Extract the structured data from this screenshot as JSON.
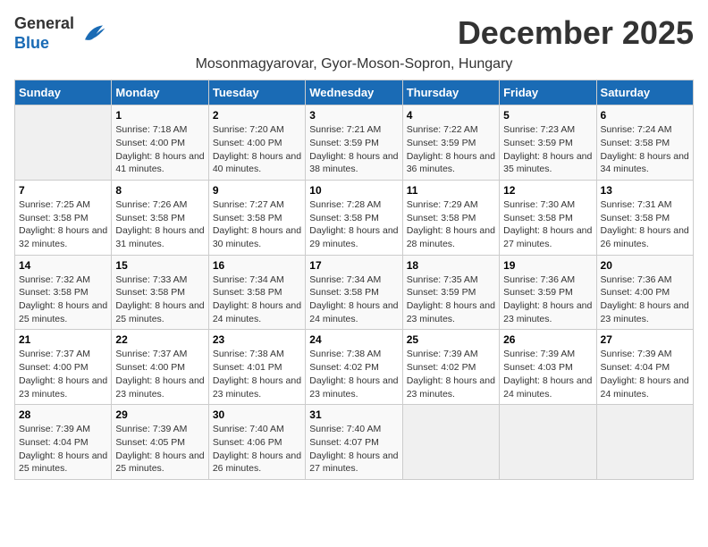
{
  "logo": {
    "general": "General",
    "blue": "Blue"
  },
  "title": "December 2025",
  "location": "Mosonmagyarovar, Gyor-Moson-Sopron, Hungary",
  "weekdays": [
    "Sunday",
    "Monday",
    "Tuesday",
    "Wednesday",
    "Thursday",
    "Friday",
    "Saturday"
  ],
  "weeks": [
    [
      {
        "day": "",
        "empty": true
      },
      {
        "day": "1",
        "sunrise": "Sunrise: 7:18 AM",
        "sunset": "Sunset: 4:00 PM",
        "daylight": "Daylight: 8 hours and 41 minutes."
      },
      {
        "day": "2",
        "sunrise": "Sunrise: 7:20 AM",
        "sunset": "Sunset: 4:00 PM",
        "daylight": "Daylight: 8 hours and 40 minutes."
      },
      {
        "day": "3",
        "sunrise": "Sunrise: 7:21 AM",
        "sunset": "Sunset: 3:59 PM",
        "daylight": "Daylight: 8 hours and 38 minutes."
      },
      {
        "day": "4",
        "sunrise": "Sunrise: 7:22 AM",
        "sunset": "Sunset: 3:59 PM",
        "daylight": "Daylight: 8 hours and 36 minutes."
      },
      {
        "day": "5",
        "sunrise": "Sunrise: 7:23 AM",
        "sunset": "Sunset: 3:59 PM",
        "daylight": "Daylight: 8 hours and 35 minutes."
      },
      {
        "day": "6",
        "sunrise": "Sunrise: 7:24 AM",
        "sunset": "Sunset: 3:58 PM",
        "daylight": "Daylight: 8 hours and 34 minutes."
      }
    ],
    [
      {
        "day": "7",
        "sunrise": "Sunrise: 7:25 AM",
        "sunset": "Sunset: 3:58 PM",
        "daylight": "Daylight: 8 hours and 32 minutes."
      },
      {
        "day": "8",
        "sunrise": "Sunrise: 7:26 AM",
        "sunset": "Sunset: 3:58 PM",
        "daylight": "Daylight: 8 hours and 31 minutes."
      },
      {
        "day": "9",
        "sunrise": "Sunrise: 7:27 AM",
        "sunset": "Sunset: 3:58 PM",
        "daylight": "Daylight: 8 hours and 30 minutes."
      },
      {
        "day": "10",
        "sunrise": "Sunrise: 7:28 AM",
        "sunset": "Sunset: 3:58 PM",
        "daylight": "Daylight: 8 hours and 29 minutes."
      },
      {
        "day": "11",
        "sunrise": "Sunrise: 7:29 AM",
        "sunset": "Sunset: 3:58 PM",
        "daylight": "Daylight: 8 hours and 28 minutes."
      },
      {
        "day": "12",
        "sunrise": "Sunrise: 7:30 AM",
        "sunset": "Sunset: 3:58 PM",
        "daylight": "Daylight: 8 hours and 27 minutes."
      },
      {
        "day": "13",
        "sunrise": "Sunrise: 7:31 AM",
        "sunset": "Sunset: 3:58 PM",
        "daylight": "Daylight: 8 hours and 26 minutes."
      }
    ],
    [
      {
        "day": "14",
        "sunrise": "Sunrise: 7:32 AM",
        "sunset": "Sunset: 3:58 PM",
        "daylight": "Daylight: 8 hours and 25 minutes."
      },
      {
        "day": "15",
        "sunrise": "Sunrise: 7:33 AM",
        "sunset": "Sunset: 3:58 PM",
        "daylight": "Daylight: 8 hours and 25 minutes."
      },
      {
        "day": "16",
        "sunrise": "Sunrise: 7:34 AM",
        "sunset": "Sunset: 3:58 PM",
        "daylight": "Daylight: 8 hours and 24 minutes."
      },
      {
        "day": "17",
        "sunrise": "Sunrise: 7:34 AM",
        "sunset": "Sunset: 3:58 PM",
        "daylight": "Daylight: 8 hours and 24 minutes."
      },
      {
        "day": "18",
        "sunrise": "Sunrise: 7:35 AM",
        "sunset": "Sunset: 3:59 PM",
        "daylight": "Daylight: 8 hours and 23 minutes."
      },
      {
        "day": "19",
        "sunrise": "Sunrise: 7:36 AM",
        "sunset": "Sunset: 3:59 PM",
        "daylight": "Daylight: 8 hours and 23 minutes."
      },
      {
        "day": "20",
        "sunrise": "Sunrise: 7:36 AM",
        "sunset": "Sunset: 4:00 PM",
        "daylight": "Daylight: 8 hours and 23 minutes."
      }
    ],
    [
      {
        "day": "21",
        "sunrise": "Sunrise: 7:37 AM",
        "sunset": "Sunset: 4:00 PM",
        "daylight": "Daylight: 8 hours and 23 minutes."
      },
      {
        "day": "22",
        "sunrise": "Sunrise: 7:37 AM",
        "sunset": "Sunset: 4:00 PM",
        "daylight": "Daylight: 8 hours and 23 minutes."
      },
      {
        "day": "23",
        "sunrise": "Sunrise: 7:38 AM",
        "sunset": "Sunset: 4:01 PM",
        "daylight": "Daylight: 8 hours and 23 minutes."
      },
      {
        "day": "24",
        "sunrise": "Sunrise: 7:38 AM",
        "sunset": "Sunset: 4:02 PM",
        "daylight": "Daylight: 8 hours and 23 minutes."
      },
      {
        "day": "25",
        "sunrise": "Sunrise: 7:39 AM",
        "sunset": "Sunset: 4:02 PM",
        "daylight": "Daylight: 8 hours and 23 minutes."
      },
      {
        "day": "26",
        "sunrise": "Sunrise: 7:39 AM",
        "sunset": "Sunset: 4:03 PM",
        "daylight": "Daylight: 8 hours and 24 minutes."
      },
      {
        "day": "27",
        "sunrise": "Sunrise: 7:39 AM",
        "sunset": "Sunset: 4:04 PM",
        "daylight": "Daylight: 8 hours and 24 minutes."
      }
    ],
    [
      {
        "day": "28",
        "sunrise": "Sunrise: 7:39 AM",
        "sunset": "Sunset: 4:04 PM",
        "daylight": "Daylight: 8 hours and 25 minutes."
      },
      {
        "day": "29",
        "sunrise": "Sunrise: 7:39 AM",
        "sunset": "Sunset: 4:05 PM",
        "daylight": "Daylight: 8 hours and 25 minutes."
      },
      {
        "day": "30",
        "sunrise": "Sunrise: 7:40 AM",
        "sunset": "Sunset: 4:06 PM",
        "daylight": "Daylight: 8 hours and 26 minutes."
      },
      {
        "day": "31",
        "sunrise": "Sunrise: 7:40 AM",
        "sunset": "Sunset: 4:07 PM",
        "daylight": "Daylight: 8 hours and 27 minutes."
      },
      {
        "day": "",
        "empty": true
      },
      {
        "day": "",
        "empty": true
      },
      {
        "day": "",
        "empty": true
      }
    ]
  ]
}
